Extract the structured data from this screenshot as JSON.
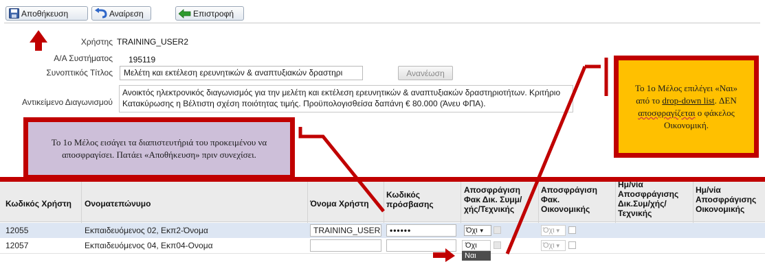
{
  "toolbar": {
    "save_label": "Αποθήκευση",
    "undo_label": "Αναίρεση",
    "back_label": "Επιστροφή"
  },
  "form": {
    "user_label": "Χρήστης",
    "user_value": "TRAINING_USER2",
    "system_id_label": "Α/Α Συστήματος",
    "system_id_value": "195119",
    "short_title_label": "Συνοπτικός Τίτλος",
    "short_title_value": "Μελέτη και εκτέλεση ερευνητικών & αναπτυξιακών δραστηρι",
    "refresh_label": "Ανανέωση",
    "subject_label": "Αντικείμενο Διαγωνισμού",
    "subject_value": "Ανοικτός ηλεκτρονικός διαγωνισμός για την  μελέτη και εκτέλεση ερευνητικών & αναπτυξιακών δραστηριοτήτων. Κριτήριο Κατακύρωσης η Βέλτιστη σχέση ποιότητας τιμής. Προϋπολογισθείσα δαπάνη € 80.000 (Άνευ ΦΠΑ)."
  },
  "notes": {
    "left_text": "Το 1ο Μέλος εισάγει τα διαπιστευτήριά του προκειμένου να αποσφραγίσει. Πατάει «Αποθήκευση» πριν συνεχίσει.",
    "right_parts": {
      "a": "Το 1ο Μέλος επιλέγει «Ναι» από το ",
      "b": "drop-down list",
      "c": ". ΔΕΝ ",
      "d": "αποσφραγίζεται",
      "e": " ο φάκελος Οικονομική."
    }
  },
  "table": {
    "headers": {
      "code": "Κωδικός Χρήστη",
      "name": "Ονοματεπώνυμο",
      "username": "Όνομα Χρήστη",
      "password": "Κωδικός πρόσβασης",
      "unseal_tech": "Αποσφράγιση Φακ Δικ. Συμμ/ χής/Τεχνικής",
      "unseal_fin": "Αποσφράγιση Φακ. Οικονομικής",
      "date_tech": "Ημ/νία Αποσφράγισης Δικ.Συμ/χής/ Τεχνικής",
      "date_fin": "Ημ/νία Αποσφράγισης Οικονομικής"
    },
    "rows": [
      {
        "code": "12055",
        "name": "Εκπαιδευόμενος 02, Εκπ2-Όνομα",
        "username": "TRAINING_USER",
        "password": "••••••",
        "tech_select": "Όχι",
        "fin_select": "Όχι"
      },
      {
        "code": "12057",
        "name": "Εκπαιδευόμενος 04, Εκπ04-Ονομα",
        "username": "",
        "password": "",
        "tech_select": "",
        "fin_select": "Όχι"
      }
    ],
    "dropdown_options": [
      "Όχι",
      "Ναι"
    ]
  },
  "colors": {
    "annotation_red": "#c00000",
    "note_purple": "#cdbfd9",
    "note_yellow": "#ffc000",
    "row_selected": "#dde6f3"
  }
}
